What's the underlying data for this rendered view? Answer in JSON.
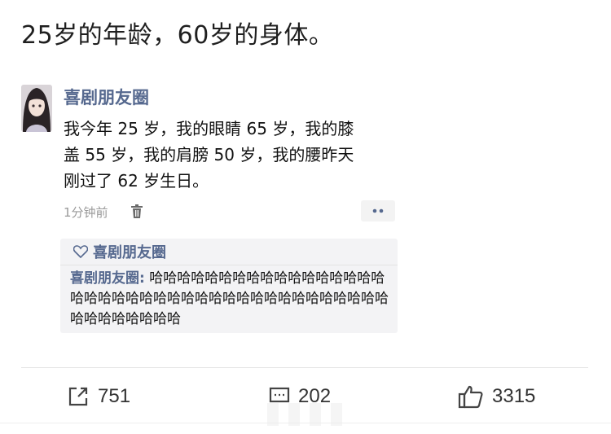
{
  "post": {
    "title": "25岁的年龄，60岁的身体。"
  },
  "moment": {
    "author": "喜剧朋友圈",
    "text": "我今年 25 岁，我的眼睛 65 岁，我的膝\n盖 55 岁，我的肩膀 50 岁，我的腰昨天\n刚过了 62 岁生日。",
    "time": "1分钟前",
    "likes_name": "喜剧朋友圈",
    "comment_author": "喜剧朋友圈:",
    "comment_text": " 哈哈哈哈哈哈哈哈哈哈哈哈哈哈哈哈哈哈哈哈哈哈哈哈哈哈哈哈哈哈哈哈哈哈哈哈哈哈哈哈哈哈哈哈哈哈哈哈"
  },
  "actions": {
    "share_count": "751",
    "comment_count": "202",
    "like_count": "3315"
  },
  "icons": [
    "avatar",
    "trash-icon",
    "more-icon",
    "heart-icon",
    "share-icon",
    "comment-icon",
    "thumbs-up-icon"
  ],
  "colors": {
    "name_blue": "#56698f",
    "comment_bg": "#f3f3f5",
    "meta_gray": "#9a9a9a"
  }
}
